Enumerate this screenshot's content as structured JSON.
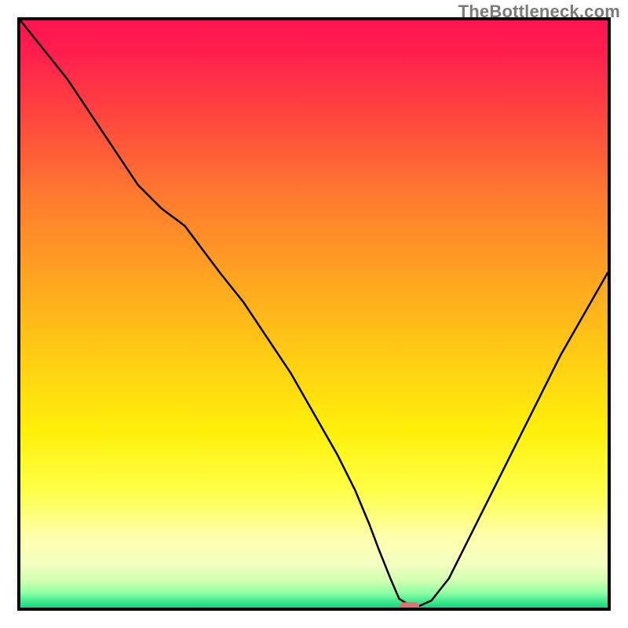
{
  "watermark": "TheBottleneck.com",
  "chart_data": {
    "type": "line",
    "title": "",
    "xlabel": "",
    "ylabel": "",
    "xlim": [
      0,
      100
    ],
    "ylim": [
      0,
      100
    ],
    "grid": false,
    "legend": false,
    "annotations": [],
    "background_gradient": {
      "type": "vertical",
      "description": "red-orange-yellow-green heat gradient, green band at bottom",
      "stops": [
        {
          "pos": 0.0,
          "color": "#ff1452"
        },
        {
          "pos": 0.05,
          "color": "#ff1d4e"
        },
        {
          "pos": 0.15,
          "color": "#ff4140"
        },
        {
          "pos": 0.3,
          "color": "#ff7a2f"
        },
        {
          "pos": 0.45,
          "color": "#ffa81f"
        },
        {
          "pos": 0.58,
          "color": "#ffcf13"
        },
        {
          "pos": 0.7,
          "color": "#fff00a"
        },
        {
          "pos": 0.8,
          "color": "#ffff47"
        },
        {
          "pos": 0.88,
          "color": "#ffffad"
        },
        {
          "pos": 0.925,
          "color": "#f5ffc1"
        },
        {
          "pos": 0.955,
          "color": "#cfffb1"
        },
        {
          "pos": 0.975,
          "color": "#8fffa5"
        },
        {
          "pos": 0.992,
          "color": "#34e58a"
        },
        {
          "pos": 1.0,
          "color": "#18d47f"
        }
      ]
    },
    "series": [
      {
        "name": "bottleneck-curve",
        "color": "#000000",
        "stroke_width": 2.5,
        "x": [
          0,
          4,
          8,
          12,
          16,
          20,
          24,
          28,
          31,
          34,
          38,
          42,
          46,
          50,
          54,
          57,
          59.5,
          61,
          63,
          64.5,
          66.5,
          68,
          70,
          73,
          76,
          80,
          84,
          88,
          92,
          96,
          100
        ],
        "values": [
          100,
          95,
          90,
          84,
          78,
          72,
          68,
          65,
          61,
          57,
          52,
          46,
          40,
          33,
          26,
          20,
          14,
          10,
          5,
          1.5,
          0.3,
          0.3,
          1.2,
          5,
          11,
          19,
          27,
          35,
          43,
          50,
          57
        ]
      }
    ],
    "marker": {
      "name": "optimum-marker",
      "shape": "rounded-rect",
      "color": "#e36f72",
      "x": 66.3,
      "y": 0.2,
      "width_pct": 3.3,
      "height_pct": 1.4
    },
    "frame": {
      "color": "#000000",
      "width": 4
    }
  }
}
